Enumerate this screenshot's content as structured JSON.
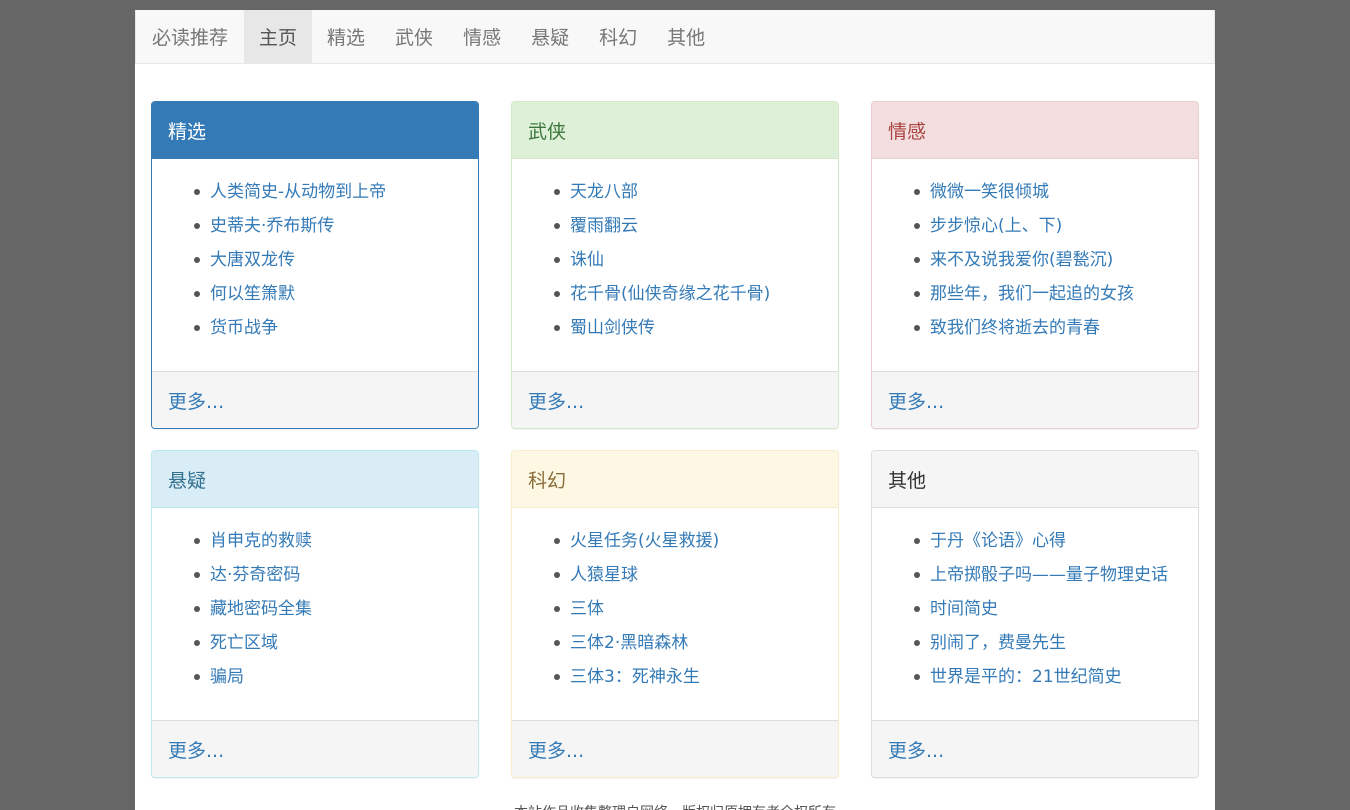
{
  "nav": {
    "brand": "必读推荐",
    "items": [
      {
        "label": "主页",
        "active": true
      },
      {
        "label": "精选"
      },
      {
        "label": "武侠"
      },
      {
        "label": "情感"
      },
      {
        "label": "悬疑"
      },
      {
        "label": "科幻"
      },
      {
        "label": "其他"
      }
    ]
  },
  "panels": [
    {
      "title": "精选",
      "style": "primary",
      "books": [
        "人类简史-从动物到上帝",
        "史蒂夫·乔布斯传",
        "大唐双龙传",
        "何以笙箫默",
        "货币战争"
      ],
      "more": "更多..."
    },
    {
      "title": "武侠",
      "style": "success",
      "books": [
        "天龙八部",
        "覆雨翻云",
        "诛仙",
        "花千骨(仙侠奇缘之花千骨)",
        "蜀山剑侠传"
      ],
      "more": "更多..."
    },
    {
      "title": "情感",
      "style": "danger",
      "books": [
        "微微一笑很倾城",
        "步步惊心(上、下)",
        "来不及说我爱你(碧甃沉)",
        "那些年，我们一起追的女孩",
        "致我们终将逝去的青春"
      ],
      "more": "更多..."
    },
    {
      "title": "悬疑",
      "style": "info",
      "books": [
        "肖申克的救赎",
        "达·芬奇密码",
        "藏地密码全集",
        "死亡区域",
        "骗局"
      ],
      "more": "更多..."
    },
    {
      "title": "科幻",
      "style": "warning",
      "books": [
        "火星任务(火星救援)",
        "人猿星球",
        "三体",
        "三体2·黑暗森林",
        "三体3：死神永生"
      ],
      "more": "更多..."
    },
    {
      "title": "其他",
      "style": "default",
      "books": [
        "于丹《论语》心得",
        "上帝掷骰子吗——量子物理史话",
        "时间简史",
        "别闹了，费曼先生",
        "世界是平的：21世纪简史"
      ],
      "more": "更多..."
    }
  ],
  "footer": {
    "text": "本站作品收集整理自网络，版权归原拥有者全权所有"
  },
  "colors": {
    "background": "#666666",
    "link": "#337ab7",
    "primary": "#337ab7",
    "success": "#dff0d8",
    "danger": "#f2dede",
    "info": "#d9edf7",
    "warning": "#fcf8e3",
    "default": "#f5f5f5"
  }
}
